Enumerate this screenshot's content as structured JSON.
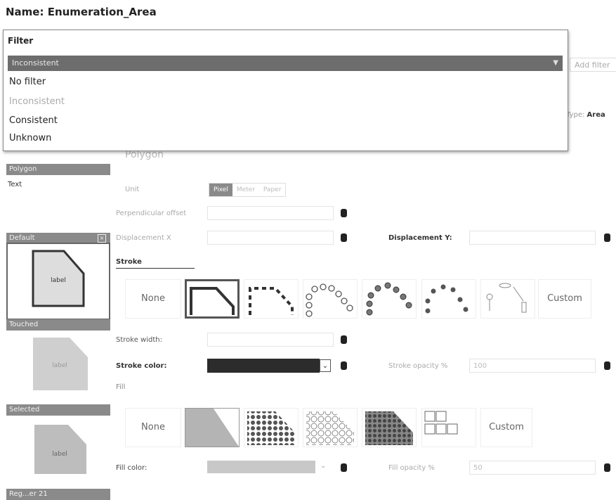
{
  "page": {
    "title": "Name: Enumeration_Area"
  },
  "filter": {
    "label": "Filter",
    "selected": "Inconsistent",
    "options": [
      "No filter",
      "Inconsistent",
      "Consistent",
      "Unknown"
    ]
  },
  "toolbar": {
    "add_filter": "Add filter",
    "type_prefix": "Type:",
    "type_value": "Area"
  },
  "sidebar": {
    "tab_polygon": "Polygon",
    "text_label": "Text",
    "default_label": "Default",
    "touched_label": "Touched",
    "selected_label": "Selected",
    "tab_bottom": "Reg...er 21",
    "sample_label": "label"
  },
  "form": {
    "section_title": "Polygon",
    "unit_label": "Unit",
    "unit_options": [
      "Pixel",
      "Meter",
      "Paper"
    ],
    "unit_selected": "Pixel",
    "perpendicular_offset": "Perpendicular offset",
    "displacement_x": "Displacement X",
    "displacement_y": "Displacement Y:",
    "stroke_title": "Stroke",
    "stroke_none": "None",
    "stroke_custom": "Custom",
    "stroke_width": "Stroke width:",
    "stroke_color": "Stroke color:",
    "stroke_opacity": "Stroke opacity %",
    "stroke_opacity_value": "100",
    "fill_title": "Fill",
    "fill_none": "None",
    "fill_custom": "Custom",
    "fill_color": "Fill color:",
    "fill_opacity": "Fill opacity %",
    "fill_opacity_value": "50"
  },
  "colors": {
    "stroke_color": "#2c2c2c",
    "fill_color": "#c8c8c8",
    "accent": "#8a8a8a"
  }
}
